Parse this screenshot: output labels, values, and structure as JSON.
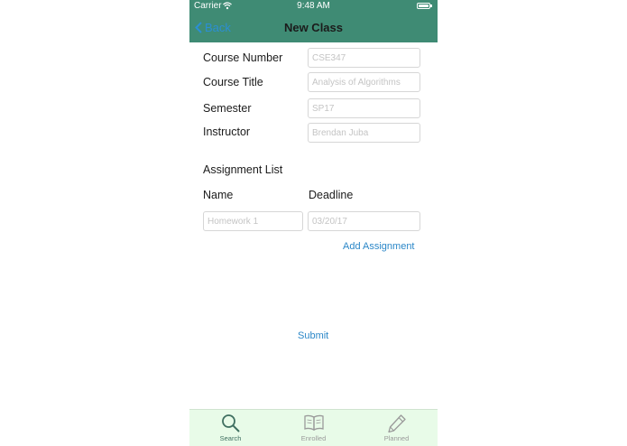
{
  "status_bar": {
    "carrier": "Carrier",
    "time": "9:48 AM"
  },
  "nav": {
    "back_label": "Back",
    "title": "New Class"
  },
  "form": {
    "course_number": {
      "label": "Course Number",
      "placeholder": "CSE347"
    },
    "course_title": {
      "label": "Course Title",
      "placeholder": "Analysis of Algorithms"
    },
    "semester": {
      "label": "Semester",
      "placeholder": "SP17"
    },
    "instructor": {
      "label": "Instructor",
      "placeholder": "Brendan Juba"
    }
  },
  "assignments": {
    "section_label": "Assignment List",
    "name_header": "Name",
    "deadline_header": "Deadline",
    "name_placeholder": "Homework 1",
    "deadline_placeholder": "03/20/17",
    "add_label": "Add Assignment"
  },
  "submit_label": "Submit",
  "tabs": [
    {
      "label": "Search",
      "icon": "search-icon",
      "active": true
    },
    {
      "label": "Enrolled",
      "icon": "book-icon",
      "active": false
    },
    {
      "label": "Planned",
      "icon": "pencil-icon",
      "active": false
    }
  ],
  "colors": {
    "header_bg": "#3f8b74",
    "link": "#2b87c8",
    "tabbar_bg": "#e8fbe8",
    "active_tab": "#3f6f60",
    "inactive_tab": "#9a9a9a"
  }
}
